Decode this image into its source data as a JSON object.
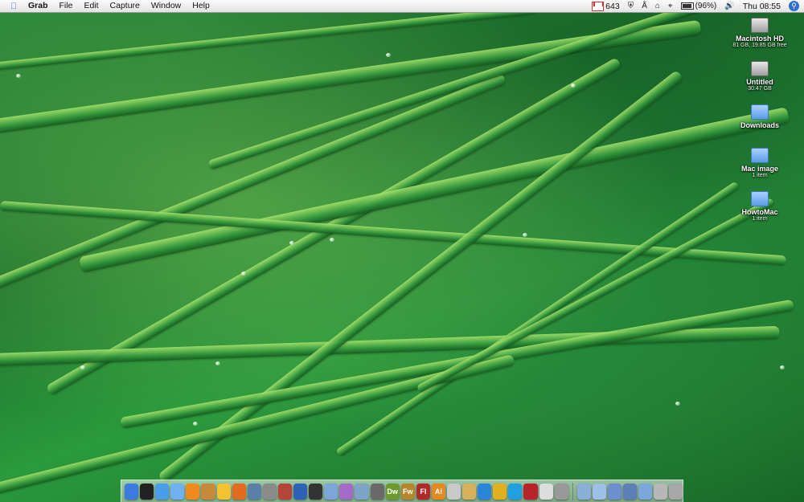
{
  "menubar": {
    "apple_icon": "apple-logo-icon",
    "app_name": "Grab",
    "menus": [
      "File",
      "Edit",
      "Capture",
      "Window",
      "Help"
    ],
    "gmail_count": "643",
    "battery_percent": "(96%)",
    "clock": "Thu 08:55",
    "tray_icons": [
      "gmail-icon",
      "shield-icon",
      "bluetooth-icon",
      "time-machine-icon",
      "wifi-icon",
      "battery-icon",
      "volume-icon",
      "spotlight-icon"
    ]
  },
  "desktop_icons": [
    {
      "name": "Macintosh HD",
      "sub": "81 GB, 19.85 GB free",
      "icon": "hard-drive-icon"
    },
    {
      "name": "Untitled",
      "sub": "30.47 GB",
      "icon": "hard-drive-icon"
    },
    {
      "name": "Downloads",
      "sub": "",
      "icon": "folder-icon"
    },
    {
      "name": "Mac image",
      "sub": "1 item",
      "icon": "folder-icon"
    },
    {
      "name": "HowtoMac",
      "sub": "1 item",
      "icon": "folder-icon"
    }
  ],
  "dock": {
    "apps": [
      {
        "name": "finder-icon",
        "label": "",
        "color": "#3b7be0"
      },
      {
        "name": "dashboard-icon",
        "label": "",
        "color": "#222222"
      },
      {
        "name": "safari-icon",
        "label": "",
        "color": "#4a9de8"
      },
      {
        "name": "itunes-icon",
        "label": "",
        "color": "#6fb0f0"
      },
      {
        "name": "vlc-icon",
        "label": "",
        "color": "#f08a1c"
      },
      {
        "name": "garageband-icon",
        "label": "",
        "color": "#c68a3a"
      },
      {
        "name": "adium-icon",
        "label": "",
        "color": "#f2c230"
      },
      {
        "name": "firefox-icon",
        "label": "",
        "color": "#e36b1f"
      },
      {
        "name": "iphoto-icon",
        "label": "",
        "color": "#5a7fa8"
      },
      {
        "name": "system-preferences-icon",
        "label": "",
        "color": "#8a8a8a"
      },
      {
        "name": "photo-booth-icon",
        "label": "",
        "color": "#b5453b"
      },
      {
        "name": "word-icon",
        "label": "",
        "color": "#2e62b5"
      },
      {
        "name": "terminal-icon",
        "label": "",
        "color": "#333333"
      },
      {
        "name": "preview-icon",
        "label": "",
        "color": "#7aa6d8"
      },
      {
        "name": "ical-icon",
        "label": "",
        "color": "#a46cc8"
      },
      {
        "name": "mail-icon",
        "label": "",
        "color": "#7da4c7"
      },
      {
        "name": "automator-icon",
        "label": "",
        "color": "#6a6a6a"
      },
      {
        "name": "dreamweaver-icon",
        "label": "Dw",
        "color": "#6e9a2d"
      },
      {
        "name": "fireworks-icon",
        "label": "Fw",
        "color": "#b3862a"
      },
      {
        "name": "flash-icon",
        "label": "Fl",
        "color": "#b02a2a"
      },
      {
        "name": "illustrator-icon",
        "label": "Ai",
        "color": "#e58a1e"
      },
      {
        "name": "textedit-icon",
        "label": "",
        "color": "#c9c9c9"
      },
      {
        "name": "address-book-icon",
        "label": "",
        "color": "#d6b05a"
      },
      {
        "name": "quicktime-icon",
        "label": "",
        "color": "#2a86d8"
      },
      {
        "name": "coda-icon",
        "label": "",
        "color": "#e0b020"
      },
      {
        "name": "skype-icon",
        "label": "",
        "color": "#1fa0e0"
      },
      {
        "name": "photo-icon",
        "label": "",
        "color": "#b8242a"
      },
      {
        "name": "app-icon-white",
        "label": "",
        "color": "#dddddd"
      },
      {
        "name": "preview-app-icon",
        "label": "",
        "color": "#999999"
      }
    ],
    "stacks": [
      {
        "name": "applications-stack-icon",
        "color": "#8ab0d8"
      },
      {
        "name": "documents-stack-icon",
        "color": "#9cc0e8"
      },
      {
        "name": "downloads-stack-icon",
        "color": "#6d8fd0"
      },
      {
        "name": "network-icon",
        "color": "#5c7fb5"
      },
      {
        "name": "folder-stack-icon",
        "color": "#7aa7da"
      },
      {
        "name": "print-queue-icon",
        "color": "#b7b7b7"
      },
      {
        "name": "trash-icon",
        "color": "#a8a8a8"
      }
    ]
  }
}
